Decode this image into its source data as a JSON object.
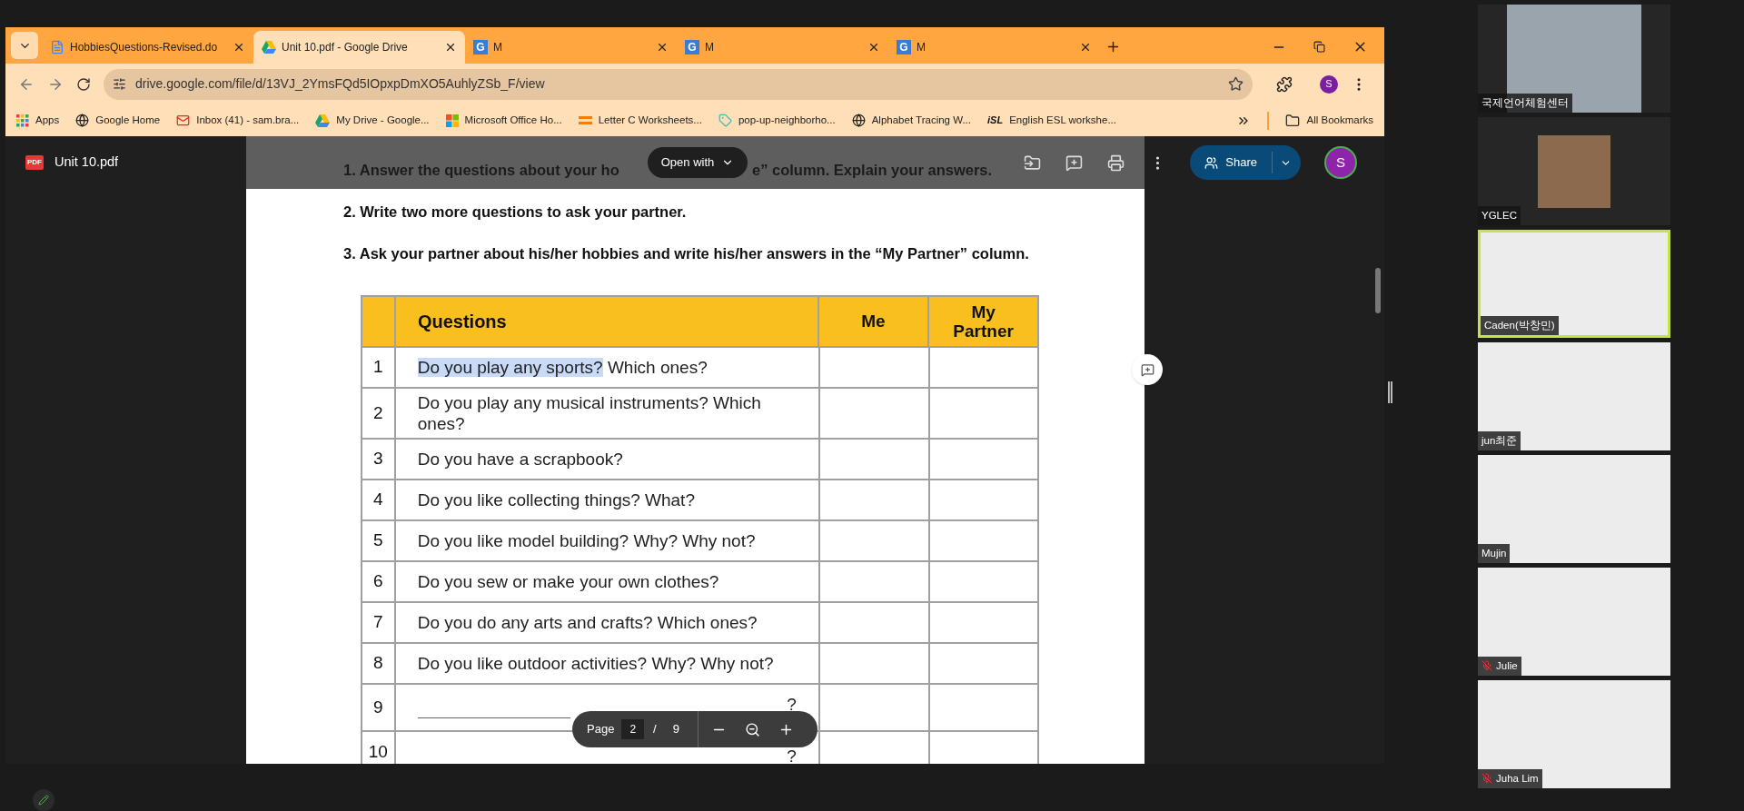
{
  "browser": {
    "tabs": [
      {
        "title": "HobbiesQuestions-Revised.do",
        "kind": "doc",
        "selected": false
      },
      {
        "title": "Unit 10.pdf - Google Drive",
        "kind": "drive",
        "selected": true
      },
      {
        "title": "M",
        "kind": "letter",
        "letter": "G",
        "selected": false
      },
      {
        "title": "M",
        "kind": "letter",
        "letter": "G",
        "selected": false
      },
      {
        "title": "M",
        "kind": "letter",
        "letter": "G",
        "selected": false
      }
    ],
    "url": "drive.google.com/file/d/13VJ_2YmsFQd5IOpxpDmXO5AuhlyZSb_F/view",
    "profile_initial": "S",
    "bookmarks": [
      {
        "label": "Apps",
        "kind": "apps"
      },
      {
        "label": "Google Home",
        "kind": "globe"
      },
      {
        "label": "Inbox (41) - sam.bra...",
        "kind": "mail"
      },
      {
        "label": "My Drive - Google...",
        "kind": "drive"
      },
      {
        "label": "Microsoft Office Ho...",
        "kind": "office"
      },
      {
        "label": "Letter C Worksheets...",
        "kind": "bars"
      },
      {
        "label": "pop-up-neighborho...",
        "kind": "tag"
      },
      {
        "label": "Alphabet Tracing W...",
        "kind": "globe"
      },
      {
        "label": "English ESL workshe...",
        "kind": "logo",
        "logo_text": "iSL"
      }
    ],
    "all_bookmarks": "All Bookmarks"
  },
  "viewer": {
    "file_icon_text": "PDF",
    "file_name": "Unit 10.pdf",
    "open_with": "Open with",
    "share": "Share",
    "avatar_initial": "S",
    "page_label": "Page",
    "page_current": "2",
    "page_separator": "/",
    "page_total": "9"
  },
  "document": {
    "instructions": [
      {
        "parts": [
          "1. Answer the questions about your ho",
          "e” column. Explain your answers."
        ]
      },
      {
        "parts": [
          "2. Write two more questions to ask your partner."
        ]
      },
      {
        "parts": [
          "3. Ask your partner about his/her hobbies and write his/her answers in the “My Partner” column."
        ]
      }
    ],
    "table": {
      "columns": [
        "Questions",
        "Me",
        "My Partner"
      ],
      "rows": [
        {
          "number": "1",
          "kind": "question",
          "selection": "Do you play any sports?",
          "text": "Which ones?"
        },
        {
          "number": "2",
          "kind": "question",
          "text": "Do you play any musical instruments? Which ones?"
        },
        {
          "number": "3",
          "kind": "question",
          "text": "Do you have a scrapbook?"
        },
        {
          "number": "4",
          "kind": "question",
          "text": "Do you like collecting things? What?"
        },
        {
          "number": "5",
          "kind": "question",
          "text": "Do you like model building? Why? Why not?"
        },
        {
          "number": "6",
          "kind": "question",
          "text": "Do you sew or make your own clothes?"
        },
        {
          "number": "7",
          "kind": "question",
          "text": "Do you do any arts and crafts? Which ones?"
        },
        {
          "number": "8",
          "kind": "question",
          "text": "Do you like outdoor activities? Why? Why not?"
        },
        {
          "number": "9",
          "kind": "blank",
          "text": "?",
          "fill_line": true
        },
        {
          "number": "10",
          "kind": "blank",
          "text": "?",
          "fill_line": false
        }
      ]
    }
  },
  "participants": [
    {
      "name": "국제언어체험센터",
      "kind": "video",
      "active": false,
      "muted": false
    },
    {
      "name": "YGLEC",
      "kind": "photo",
      "active": false,
      "muted": false
    },
    {
      "name": "Caden(박창민)",
      "kind": "blank",
      "active": true,
      "muted": false
    },
    {
      "name": "jun최준",
      "kind": "blank",
      "active": false,
      "muted": false
    },
    {
      "name": "Mujin",
      "kind": "blank",
      "active": false,
      "muted": false
    },
    {
      "name": "Julie",
      "kind": "blank",
      "active": false,
      "muted": true
    },
    {
      "name": "Juha Lim",
      "kind": "blank",
      "active": false,
      "muted": true
    }
  ]
}
